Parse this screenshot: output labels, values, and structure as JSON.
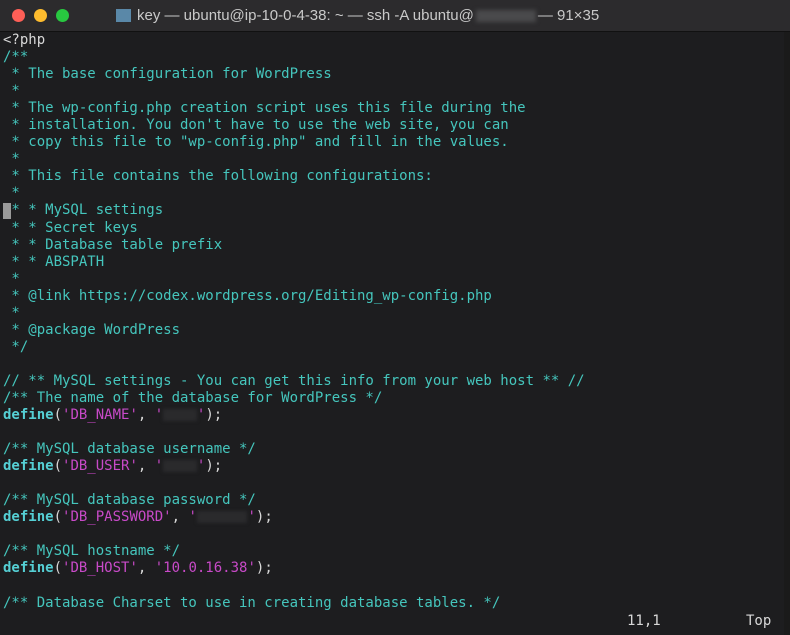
{
  "window": {
    "title": "key — ubuntu@ip-10-0-4-38: ~ — ssh -A ubuntu@",
    "title_suffix": "— 91×35",
    "colors": {
      "close": "#fe5f57",
      "minimize": "#febc2e",
      "zoom": "#28c840",
      "comment": "#45c6bd",
      "keyword": "#55cfd4",
      "string": "#c84ac8"
    }
  },
  "lines": [
    [
      [
        "p",
        "<?php"
      ]
    ],
    [
      [
        "c",
        "/**"
      ]
    ],
    [
      [
        "c",
        " * The base configuration for WordPress"
      ]
    ],
    [
      [
        "c",
        " *"
      ]
    ],
    [
      [
        "c",
        " * The wp-config.php creation script uses this file during the"
      ]
    ],
    [
      [
        "c",
        " * installation. You don't have to use the web site, you can"
      ]
    ],
    [
      [
        "c",
        " * copy this file to \"wp-config.php\" and fill in the values."
      ]
    ],
    [
      [
        "c",
        " *"
      ]
    ],
    [
      [
        "c",
        " * This file contains the following configurations:"
      ]
    ],
    [
      [
        "c",
        " *"
      ]
    ],
    [
      [
        "c",
        " * * MySQL settings"
      ]
    ],
    [
      [
        "c",
        " * * Secret keys"
      ]
    ],
    [
      [
        "c",
        " * * Database table prefix"
      ]
    ],
    [
      [
        "c",
        " * * ABSPATH"
      ]
    ],
    [
      [
        "c",
        " *"
      ]
    ],
    [
      [
        "c",
        " * @link https://codex.wordpress.org/Editing_wp-config.php"
      ]
    ],
    [
      [
        "c",
        " *"
      ]
    ],
    [
      [
        "c",
        " * @package WordPress"
      ]
    ],
    [
      [
        "c",
        " */"
      ]
    ],
    [],
    [
      [
        "c",
        "// ** MySQL settings - You can get this info from your web host ** //"
      ]
    ],
    [
      [
        "c",
        "/** The name of the database for WordPress */"
      ]
    ],
    [
      [
        "k",
        "define"
      ],
      [
        "p",
        "("
      ],
      [
        "s",
        "'DB_NAME'"
      ],
      [
        "p",
        ", "
      ],
      [
        "s",
        "'"
      ],
      [
        "r",
        "4"
      ],
      [
        "s",
        "'"
      ],
      [
        "p",
        ");"
      ]
    ],
    [],
    [
      [
        "c",
        "/** MySQL database username */"
      ]
    ],
    [
      [
        "k",
        "define"
      ],
      [
        "p",
        "("
      ],
      [
        "s",
        "'DB_USER'"
      ],
      [
        "p",
        ", "
      ],
      [
        "s",
        "'"
      ],
      [
        "r",
        "4"
      ],
      [
        "s",
        "'"
      ],
      [
        "p",
        ");"
      ]
    ],
    [],
    [
      [
        "c",
        "/** MySQL database password */"
      ]
    ],
    [
      [
        "k",
        "define"
      ],
      [
        "p",
        "("
      ],
      [
        "s",
        "'DB_PASSWORD'"
      ],
      [
        "p",
        ", "
      ],
      [
        "s",
        "'"
      ],
      [
        "r",
        "6"
      ],
      [
        "s",
        "'"
      ],
      [
        "p",
        ");"
      ]
    ],
    [],
    [
      [
        "c",
        "/** MySQL hostname */"
      ]
    ],
    [
      [
        "k",
        "define"
      ],
      [
        "p",
        "("
      ],
      [
        "s",
        "'DB_HOST'"
      ],
      [
        "p",
        ", "
      ],
      [
        "s",
        "'10.0.16.38'"
      ],
      [
        "p",
        ");"
      ]
    ],
    [],
    [
      [
        "c",
        "/** Database Charset to use in creating database tables. */"
      ]
    ]
  ],
  "status": {
    "position": "11,1",
    "scroll": "Top"
  }
}
